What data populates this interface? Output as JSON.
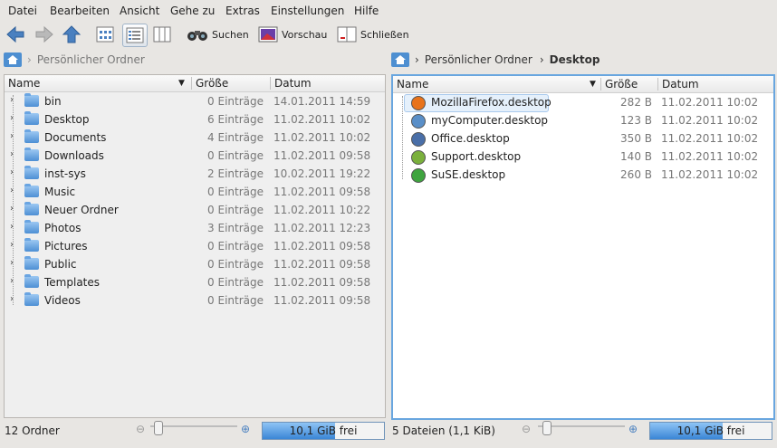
{
  "menu": [
    "Datei",
    "Bearbeiten",
    "Ansicht",
    "Gehe zu",
    "Extras",
    "Einstellungen",
    "Hilfe"
  ],
  "toolbar": {
    "search": "Suchen",
    "preview": "Vorschau",
    "close": "Schließen"
  },
  "left": {
    "breadcrumb": "Persönlicher Ordner",
    "columns": {
      "name": "Name",
      "size": "Größe",
      "date": "Datum"
    },
    "rows": [
      {
        "name": "bin",
        "size": "0 Einträge",
        "date": "14.01.2011 14:59",
        "icon": "folder-icon"
      },
      {
        "name": "Desktop",
        "size": "6 Einträge",
        "date": "11.02.2011 10:02",
        "icon": "desktop-folder-icon"
      },
      {
        "name": "Documents",
        "size": "4 Einträge",
        "date": "11.02.2011 10:02",
        "icon": "documents-folder-icon"
      },
      {
        "name": "Downloads",
        "size": "0 Einträge",
        "date": "11.02.2011 09:58",
        "icon": "folder-icon"
      },
      {
        "name": "inst-sys",
        "size": "2 Einträge",
        "date": "10.02.2011 19:22",
        "icon": "folder-icon"
      },
      {
        "name": "Music",
        "size": "0 Einträge",
        "date": "11.02.2011 09:58",
        "icon": "folder-icon"
      },
      {
        "name": "Neuer Ordner",
        "size": "0 Einträge",
        "date": "11.02.2011 10:22",
        "icon": "folder-icon"
      },
      {
        "name": "Photos",
        "size": "3 Einträge",
        "date": "11.02.2011 12:23",
        "icon": "folder-icon"
      },
      {
        "name": "Pictures",
        "size": "0 Einträge",
        "date": "11.02.2011 09:58",
        "icon": "folder-icon"
      },
      {
        "name": "Public",
        "size": "0 Einträge",
        "date": "11.02.2011 09:58",
        "icon": "folder-icon"
      },
      {
        "name": "Templates",
        "size": "0 Einträge",
        "date": "11.02.2011 09:58",
        "icon": "folder-icon"
      },
      {
        "name": "Videos",
        "size": "0 Einträge",
        "date": "11.02.2011 09:58",
        "icon": "folder-icon"
      }
    ],
    "status": "12 Ordner",
    "free": "10,1 GiB frei",
    "free_fraction": 0.6
  },
  "right": {
    "breadcrumb_parent": "Persönlicher Ordner",
    "breadcrumb_current": "Desktop",
    "columns": {
      "name": "Name",
      "size": "Größe",
      "date": "Datum"
    },
    "rows": [
      {
        "name": "MozillaFirefox.desktop",
        "size": "282 B",
        "date": "11.02.2011 10:02",
        "icon": "firefox-icon",
        "color": "#e8731b"
      },
      {
        "name": "myComputer.desktop",
        "size": "123 B",
        "date": "11.02.2011 10:02",
        "icon": "computer-icon",
        "color": "#5a8fc8"
      },
      {
        "name": "Office.desktop",
        "size": "350 B",
        "date": "11.02.2011 10:02",
        "icon": "office-icon",
        "color": "#4a6fa8"
      },
      {
        "name": "Support.desktop",
        "size": "140 B",
        "date": "11.02.2011 10:02",
        "icon": "support-icon",
        "color": "#7ab03c"
      },
      {
        "name": "SuSE.desktop",
        "size": "260 B",
        "date": "11.02.2011 10:02",
        "icon": "suse-icon",
        "color": "#3fa43f"
      }
    ],
    "status": "5 Dateien (1,1 KiB)",
    "free": "10,1 GiB frei",
    "free_fraction": 0.6
  }
}
